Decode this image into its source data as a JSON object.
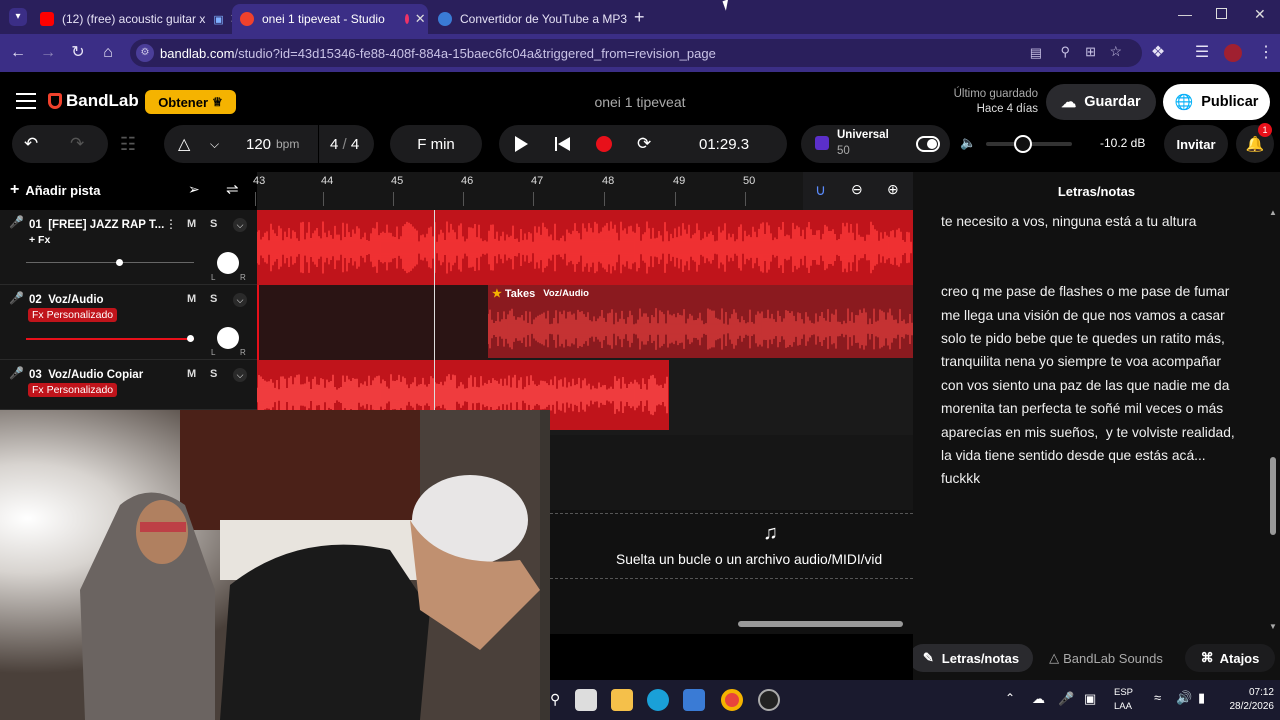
{
  "browser": {
    "tabs": [
      {
        "title": "(12) (free) acoustic guitar x",
        "favicon_color": "#ff0000"
      },
      {
        "title": "onei 1 tipeveat - Studio",
        "favicon_color": "#f0412c",
        "active": true
      },
      {
        "title": "Convertidor de YouTube a MP3",
        "favicon_color": "#3a7bd5"
      }
    ],
    "url_host": "bandlab.com",
    "url_path": "/studio?id=43d15346-fe88-408f-884a-15baec6fc04a&triggered_from=revision_page"
  },
  "header": {
    "brand": "BandLab",
    "obtener_label": "Obtener",
    "project_title": "onei 1 tipeveat",
    "last_saved_label": "Último guardado",
    "last_saved_value": "Hace 4 días",
    "save_label": "Guardar",
    "publish_label": "Publicar"
  },
  "transport": {
    "tempo": "120",
    "tempo_unit": "bpm",
    "time_sig_num": "4",
    "time_sig_sep": "/",
    "time_sig_den": "4",
    "key": "F min",
    "time": "01:29.3",
    "instrument_name": "Universal",
    "instrument_value": "50",
    "volume_db": "-10.2 dB",
    "invite_label": "Invitar",
    "notification_count": "1"
  },
  "toolbar": {
    "add_track_label": "Añadir pista"
  },
  "ruler": {
    "bars": [
      "43",
      "44",
      "45",
      "46",
      "47",
      "48",
      "49",
      "50"
    ]
  },
  "tracks": [
    {
      "number": "01",
      "name": "[FREE] JAZZ RAP T...",
      "fx": "+ Fx",
      "volume": 0.56
    },
    {
      "number": "02",
      "name": "Voz/Audio",
      "fx": "Fx Personalizado",
      "volume": 0.98
    },
    {
      "number": "03",
      "name": "Voz/Audio Copiar",
      "fx": "Fx Personalizado"
    }
  ],
  "clips": {
    "takes_label": "Takes",
    "takes_track": "Voz/Audio"
  },
  "dropzone": {
    "text": "Suelta un bucle o un archivo audio/MIDI/vid"
  },
  "right_panel": {
    "title": "Letras/notas",
    "lyrics": [
      "te necesito a vos, ninguna está a tu altura",
      "",
      "",
      "creo q me pase de flashes o me pase de fumar",
      "me llega una visión de que nos vamos a casar",
      "solo te pido bebe que te quedes un ratito más, tranquilita nena yo siempre te voa acompañar",
      "con vos siento una paz de las que nadie me da",
      "morenita tan perfecta te soñé mil veces o más",
      "aparecías en mis sueños,  y te volviste realidad,",
      "la vida tiene sentido desde que estás acá...",
      "fuckkk"
    ],
    "tab_lyrics": "Letras/notas",
    "tab_sounds": "BandLab Sounds",
    "tab_shortcuts": "Atajos"
  },
  "taskbar": {
    "lang": "ESP",
    "lang2": "LAA",
    "time": "07:12",
    "date": "28/2/2026"
  },
  "colors": {
    "accent": "#f0412c",
    "clip_red": "#c0141b",
    "brand_purple": "#3b2e86",
    "obtener_yellow": "#f5b300"
  }
}
